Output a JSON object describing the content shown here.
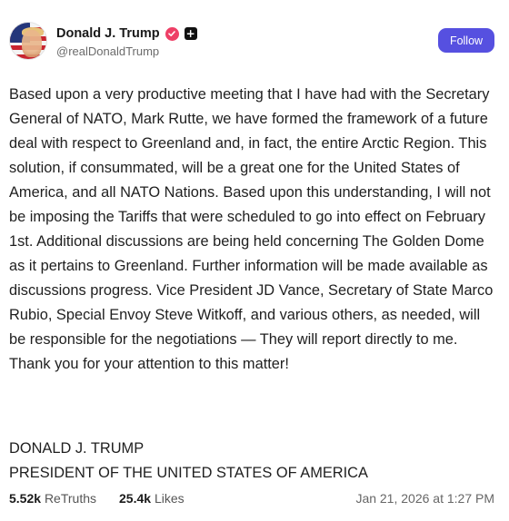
{
  "author": {
    "name": "Donald J. Trump",
    "handle": "@realDonaldTrump",
    "plus_badge": "+"
  },
  "actions": {
    "follow_label": "Follow"
  },
  "post": {
    "text": "Based upon a very productive meeting that I have had with the Secretary General of NATO, Mark Rutte, we have formed the framework of a future deal with respect to Greenland and, in fact, the entire Arctic Region. This solution, if consummated, will be a great one for the United States of America, and all NATO Nations. Based upon this understanding, I will not be imposing the Tariffs that were scheduled to go into effect on February 1st. Additional discussions are being held concerning The Golden Dome as it pertains to Greenland. Further information will be made available as discussions progress. Vice President JD Vance, Secretary of State Marco Rubio, Special Envoy Steve Witkoff, and various others, as needed, will be responsible for the negotiations — They will report directly to me. Thank you for your attention to this matter!",
    "signature_line1": "DONALD J. TRUMP",
    "signature_line2": "PRESIDENT OF THE UNITED STATES OF AMERICA"
  },
  "stats": {
    "retruths_count": "5.52k",
    "retruths_label": "ReTruths",
    "likes_count": "25.4k",
    "likes_label": "Likes",
    "timestamp": "Jan 21, 2026 at 1:27 PM"
  },
  "colors": {
    "follow_button": "#5650e0",
    "verified_badge": "#ee3f66"
  },
  "icons": {
    "verified": "verified-check-icon",
    "plus": "plus-badge-icon"
  }
}
